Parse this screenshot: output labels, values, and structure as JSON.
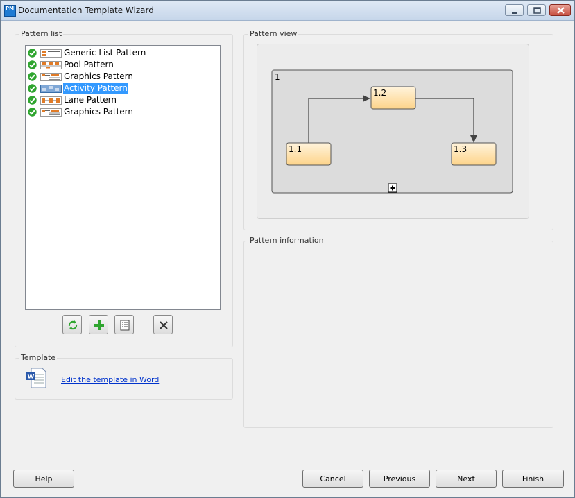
{
  "window": {
    "title": "Documentation Template Wizard",
    "app_icon_text": "PM",
    "controls": [
      "minimize-icon",
      "maximize-icon",
      "close-icon"
    ]
  },
  "pattern_list": {
    "label": "Pattern list",
    "items": [
      {
        "label": "Generic List Pattern",
        "status": "check-icon",
        "icon": "generic-list-pattern-icon",
        "selected": false
      },
      {
        "label": "Pool Pattern",
        "status": "check-icon",
        "icon": "pool-pattern-icon",
        "selected": false
      },
      {
        "label": "Graphics Pattern",
        "status": "check-icon",
        "icon": "graphics-pattern-icon",
        "selected": false
      },
      {
        "label": "Activity Pattern",
        "status": "check-icon",
        "icon": "activity-pattern-icon",
        "selected": true
      },
      {
        "label": "Lane Pattern",
        "status": "check-icon",
        "icon": "lane-pattern-icon",
        "selected": false
      },
      {
        "label": "Graphics Pattern",
        "status": "check-icon",
        "icon": "graphics-pattern-icon",
        "selected": false
      }
    ],
    "toolbar": [
      "refresh-icon",
      "add-icon",
      "properties-icon",
      "delete-icon"
    ]
  },
  "template": {
    "label": "Template",
    "icon": "word-document-icon",
    "link_text": "Edit the template in Word"
  },
  "pattern_view": {
    "label": "Pattern view",
    "diagram": {
      "container_label": "1",
      "nodes": [
        "1.1",
        "1.2",
        "1.3"
      ],
      "expand_icon": "plus-box-icon"
    }
  },
  "pattern_information": {
    "label": "Pattern information"
  },
  "buttons": {
    "help": "Help",
    "cancel": "Cancel",
    "previous": "Previous",
    "next": "Next",
    "finish": "Finish"
  },
  "colors": {
    "selection": "#3399ff",
    "node_fill_top": "#fff4dc",
    "node_fill_bottom": "#fdd48a",
    "check_green": "#2fa52f",
    "link_blue": "#0033cc"
  }
}
